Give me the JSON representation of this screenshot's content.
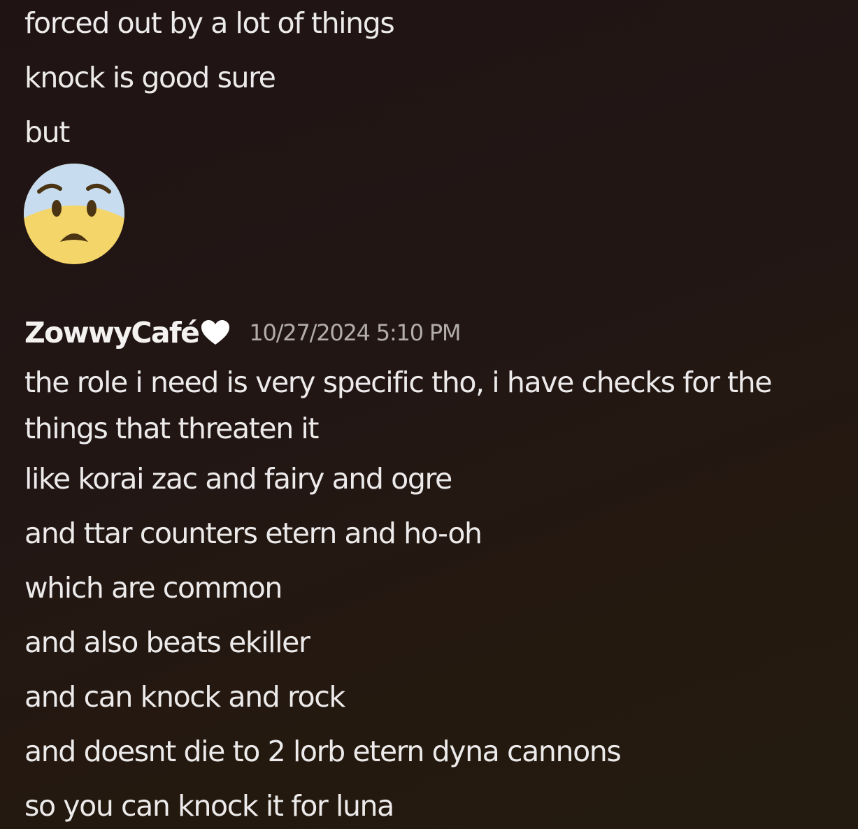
{
  "messages_top": [
    "forced out by a lot of things",
    "knock is good sure",
    "but"
  ],
  "emoji": {
    "name": "anguished-fearful-face-emoji"
  },
  "author": {
    "username": "ZowwyCafé",
    "badge_icon": "white-heart-icon",
    "timestamp": "10/27/2024 5:10 PM"
  },
  "messages_bottom": [
    "the role i need is very specific tho, i have checks for the things that threaten it",
    "like korai zac and fairy and ogre",
    "and ttar counters etern and ho-oh",
    "which are common",
    "and also beats ekiller",
    "and can knock and rock",
    "and doesnt die to 2 lorb etern dyna cannons",
    "so you can knock it for luna"
  ],
  "colors": {
    "text": "#eceaea",
    "timestamp": "#b2adaa",
    "background_top": "#1f1314",
    "background_bottom": "#231a10"
  }
}
